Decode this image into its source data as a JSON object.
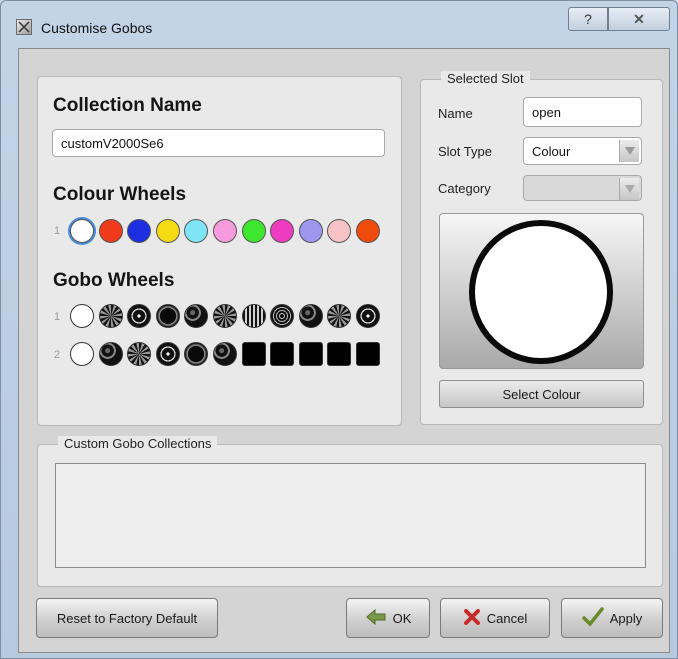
{
  "window": {
    "title": "Customise Gobos",
    "help_label": "?",
    "close_label": "✕"
  },
  "collection": {
    "heading": "Collection Name",
    "name_value": "customV2000Se6",
    "colour_wheels_heading": "Colour Wheels",
    "colour_row_number": "1",
    "colours": [
      "#ffffff",
      "#ef3b1c",
      "#1d2fe0",
      "#f5dc12",
      "#7de5f5",
      "#f59bdc",
      "#3fe62f",
      "#ef3bc0",
      "#9d97f0",
      "#f6c2c6",
      "#f04a0c"
    ],
    "gobo_wheels_heading": "Gobo Wheels",
    "gobo_rows": [
      {
        "number": "1",
        "gobos": [
          "open",
          "pattern",
          "pattern",
          "ring",
          "pattern",
          "pattern",
          "stripes",
          "pattern",
          "pattern",
          "pattern",
          "pattern"
        ]
      },
      {
        "number": "2",
        "gobos": [
          "open",
          "pattern",
          "pattern",
          "pattern",
          "ring",
          "pattern",
          "blank",
          "blank",
          "blank",
          "blank",
          "blank"
        ]
      }
    ]
  },
  "selected_slot": {
    "legend": "Selected Slot",
    "name_label": "Name",
    "name_value": "open",
    "slot_type_label": "Slot Type",
    "slot_type_value": "Colour",
    "category_label": "Category",
    "category_value": "",
    "preview_colour": "#ffffff",
    "select_colour_label": "Select Colour"
  },
  "custom_collections": {
    "legend": "Custom Gobo Collections"
  },
  "buttons": {
    "reset_label": "Reset to Factory Default",
    "ok_label": "OK",
    "cancel_label": "Cancel",
    "apply_label": "Apply"
  }
}
